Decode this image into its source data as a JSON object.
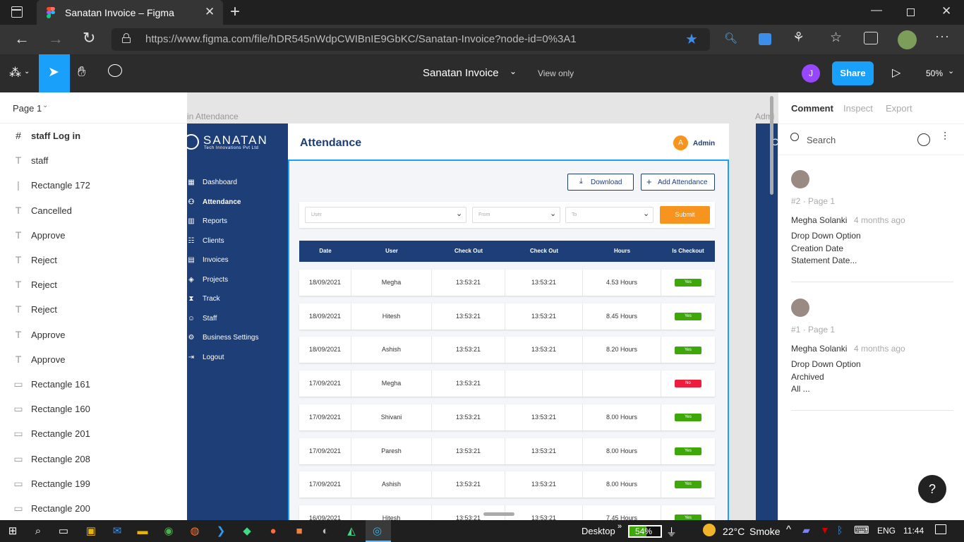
{
  "browser": {
    "tab_title": "Sanatan Invoice – Figma",
    "url": "https://www.figma.com/file/hDR545nWdpCWIBnIE9GbKC/Sanatan-Invoice?node-id=0%3A1"
  },
  "figma": {
    "file_title": "Sanatan Invoice",
    "view_mode": "View only",
    "user_initial": "J",
    "share_label": "Share",
    "zoom": "50%"
  },
  "layers": {
    "page_label": "Page 1",
    "items": [
      {
        "icon": "#",
        "label": "staff Log in"
      },
      {
        "icon": "T",
        "label": "staff"
      },
      {
        "icon": "|",
        "label": "Rectangle 172"
      },
      {
        "icon": "T",
        "label": "Cancelled"
      },
      {
        "icon": "T",
        "label": "Approve"
      },
      {
        "icon": "T",
        "label": "Reject"
      },
      {
        "icon": "T",
        "label": "Reject"
      },
      {
        "icon": "T",
        "label": "Reject"
      },
      {
        "icon": "T",
        "label": "Approve"
      },
      {
        "icon": "T",
        "label": "Approve"
      },
      {
        "icon": "▭",
        "label": "Rectangle 161"
      },
      {
        "icon": "▭",
        "label": "Rectangle 160"
      },
      {
        "icon": "▭",
        "label": "Rectangle 201"
      },
      {
        "icon": "▭",
        "label": "Rectangle 208"
      },
      {
        "icon": "▭",
        "label": "Rectangle 199"
      },
      {
        "icon": "▭",
        "label": "Rectangle 200"
      }
    ]
  },
  "canvas": {
    "frame_label_left": "in Attendance",
    "frame_label_right": "Admi",
    "brand_name": "SANATAN",
    "brand_sub": "Tech Innovations Pvt Ltd",
    "page_title": "Attendance",
    "admin_initial": "A",
    "admin_label": "Admin",
    "nav": [
      {
        "icon": "▦",
        "label": "Dashboard"
      },
      {
        "icon": "⚇",
        "label": "Attendance"
      },
      {
        "icon": "▥",
        "label": "Reports"
      },
      {
        "icon": "☷",
        "label": "Clients"
      },
      {
        "icon": "▤",
        "label": "Invoices"
      },
      {
        "icon": "◈",
        "label": "Projects"
      },
      {
        "icon": "⧗",
        "label": "Track"
      },
      {
        "icon": "☺",
        "label": "Staff"
      },
      {
        "icon": "⚙",
        "label": "Business Settings"
      },
      {
        "icon": "⇥",
        "label": "Logout"
      }
    ],
    "download_label": "Download",
    "add_label": "Add Attendance",
    "filters": {
      "user": "User",
      "from": "From",
      "to": "To",
      "submit": "Submit"
    },
    "headers": [
      "Date",
      "User",
      "Check Out",
      "Check Out",
      "Hours",
      "Is Checkout"
    ],
    "rows": [
      {
        "date": "18/09/2021",
        "user": "Megha",
        "in": "13:53:21",
        "out": "13:53:21",
        "hours": "4.53 Hours",
        "status": "Yes"
      },
      {
        "date": "18/09/2021",
        "user": "Hitesh",
        "in": "13:53:21",
        "out": "13:53:21",
        "hours": "8.45 Hours",
        "status": "Yes"
      },
      {
        "date": "18/09/2021",
        "user": "Ashish",
        "in": "13:53:21",
        "out": "13:53:21",
        "hours": "8.20 Hours",
        "status": "Yes"
      },
      {
        "date": "17/09/2021",
        "user": "Megha",
        "in": "13:53:21",
        "out": "",
        "hours": "",
        "status": "No"
      },
      {
        "date": "17/09/2021",
        "user": "Shivani",
        "in": "13:53:21",
        "out": "13:53:21",
        "hours": "8.00 Hours",
        "status": "Yes"
      },
      {
        "date": "17/09/2021",
        "user": "Paresh",
        "in": "13:53:21",
        "out": "13:53:21",
        "hours": "8.00 Hours",
        "status": "Yes"
      },
      {
        "date": "17/09/2021",
        "user": "Ashish",
        "in": "13:53:21",
        "out": "13:53:21",
        "hours": "8.00 Hours",
        "status": "Yes"
      },
      {
        "date": "16/09/2021",
        "user": "Hitesh",
        "in": "13:53:21",
        "out": "13:53:21",
        "hours": "7.45 Hours",
        "status": "Yes"
      }
    ],
    "colors": {
      "navy": "#1e3e78",
      "orange": "#f7941d",
      "yes": "#3ea80b",
      "no": "#ee1d3e",
      "selection": "#18a0fb"
    }
  },
  "right_panel": {
    "tabs": [
      "Comment",
      "Inspect",
      "Export"
    ],
    "search_placeholder": "Search",
    "comments": [
      {
        "ref": "#2 · Page 1",
        "author": "Megha Solanki",
        "time": "4 months ago",
        "lines": [
          "Drop Down Option",
          "Creation Date",
          "Statement Date..."
        ]
      },
      {
        "ref": "#1 · Page 1",
        "author": "Megha Solanki",
        "time": "4 months ago",
        "lines": [
          "Drop Down Option",
          "Archived",
          "All ..."
        ]
      }
    ],
    "help": "?"
  },
  "taskbar": {
    "desktop": "Desktop",
    "battery": "54%",
    "weather_temp": "22°C",
    "weather_text": "Smoke",
    "lang": "ENG",
    "time": "11:44"
  }
}
